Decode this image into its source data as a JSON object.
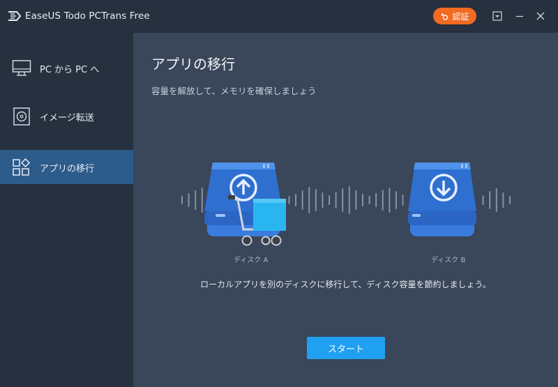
{
  "app": {
    "title": "EaseUS Todo PCTrans Free",
    "auth_label": "認証"
  },
  "sidebar": {
    "items": [
      {
        "label": "PC から PC へ",
        "icon": "monitor-icon",
        "active": false
      },
      {
        "label": "イメージ転送",
        "icon": "disc-image-icon",
        "active": false
      },
      {
        "label": "アプリの移行",
        "icon": "apps-grid-icon",
        "active": true
      }
    ]
  },
  "main": {
    "title": "アプリの移行",
    "subtitle": "容量を解放して、メモリを確保しましょう",
    "disk_a_label": "ディスク A",
    "disk_b_label": "ディスク B",
    "description": "ローカルアプリを別のディスクに移行して、ディスク容量を節約しましょう。",
    "start_label": "スタート"
  },
  "colors": {
    "accent": "#20a0f0",
    "auth": "#f26b21",
    "sidebar_active": "#2d5b8a",
    "disk_blue": "#2f6fd0"
  }
}
